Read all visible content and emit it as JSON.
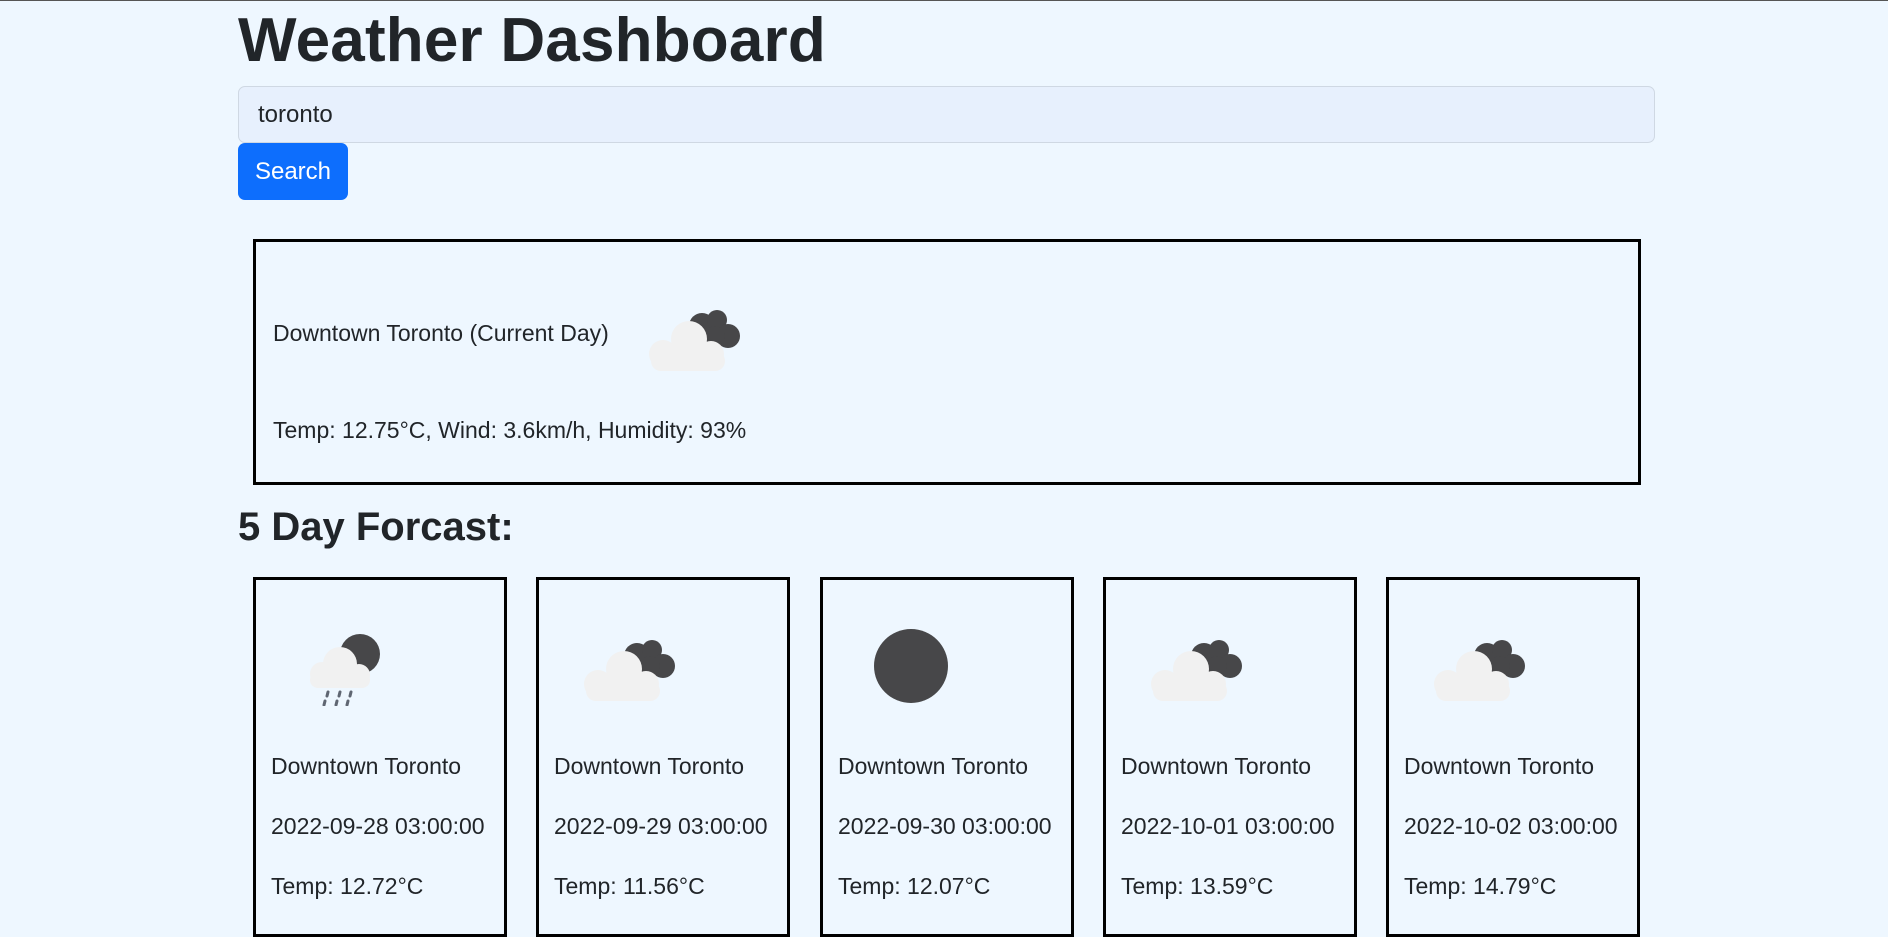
{
  "header": {
    "title": "Weather Dashboard"
  },
  "search": {
    "value": "toronto",
    "button_label": "Search"
  },
  "current": {
    "city_label": "Downtown Toronto (Current Day)",
    "icon": "broken-clouds-icon",
    "stats": "Temp: 12.75°C, Wind: 3.6km/h, Humidity: 93%"
  },
  "forecast": {
    "heading": "5 Day Forcast:",
    "days": [
      {
        "city": "Downtown Toronto",
        "date": "2022-09-28 03:00:00",
        "temp": "Temp: 12.72°C",
        "icon": "rain-night-icon"
      },
      {
        "city": "Downtown Toronto",
        "date": "2022-09-29 03:00:00",
        "temp": "Temp: 11.56°C",
        "icon": "broken-clouds-icon"
      },
      {
        "city": "Downtown Toronto",
        "date": "2022-09-30 03:00:00",
        "temp": "Temp: 12.07°C",
        "icon": "clear-night-icon"
      },
      {
        "city": "Downtown Toronto",
        "date": "2022-10-01 03:00:00",
        "temp": "Temp: 13.59°C",
        "icon": "broken-clouds-icon"
      },
      {
        "city": "Downtown Toronto",
        "date": "2022-10-02 03:00:00",
        "temp": "Temp: 14.79°C",
        "icon": "broken-clouds-icon"
      }
    ]
  },
  "colors": {
    "background": "#eef7ff",
    "accent": "#0d6efd",
    "text": "#212529",
    "icon_dark": "#474749",
    "icon_light": "#f1f1f1"
  }
}
